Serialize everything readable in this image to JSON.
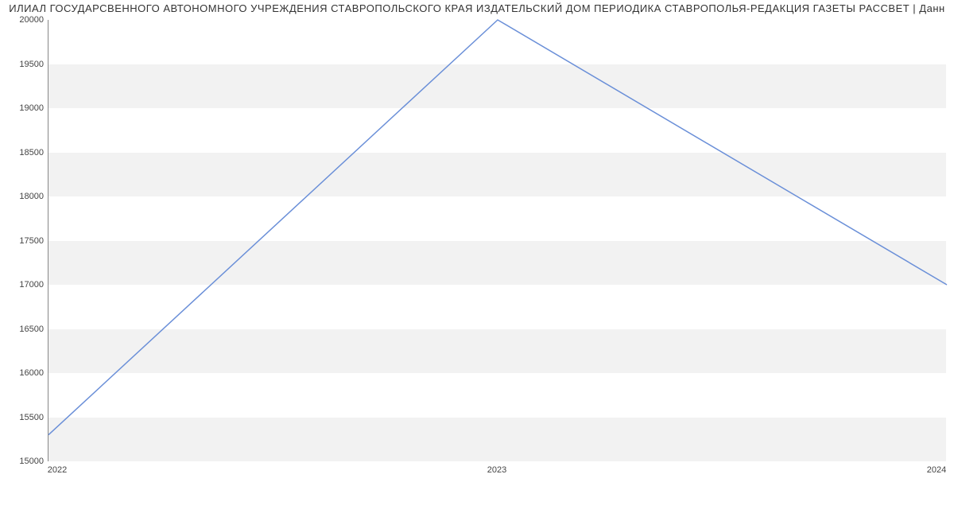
{
  "chart_data": {
    "type": "line",
    "title": "ИЛИАЛ ГОСУДАРСВЕННОГО АВТОНОМНОГО УЧРЕЖДЕНИЯ СТАВРОПОЛЬСКОГО КРАЯ ИЗДАТЕЛЬСКИЙ ДОМ ПЕРИОДИКА СТАВРОПОЛЬЯ-РЕДАКЦИЯ ГАЗЕТЫ РАССВЕТ | Данн",
    "categories": [
      "2022",
      "2023",
      "2024"
    ],
    "values": [
      15300,
      20000,
      17000
    ],
    "xlabel": "",
    "ylabel": "",
    "ylim": [
      15000,
      20000
    ],
    "y_ticks": [
      15000,
      15500,
      16000,
      16500,
      17000,
      17500,
      18000,
      18500,
      19000,
      19500,
      20000
    ]
  }
}
